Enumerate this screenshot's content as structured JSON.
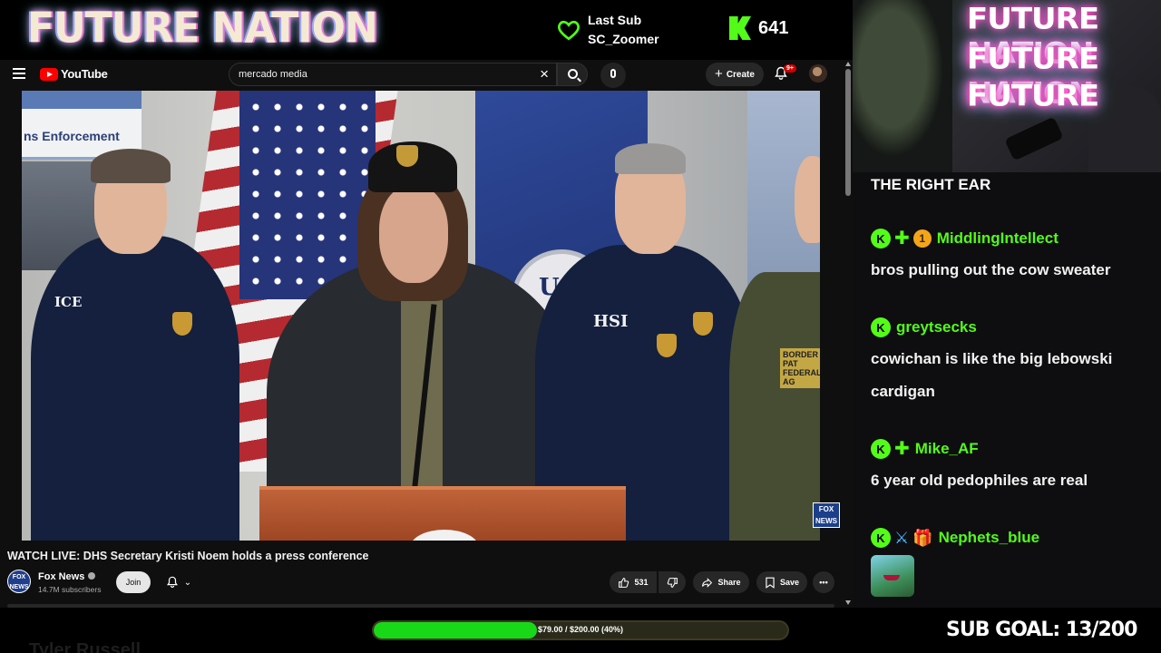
{
  "overlay": {
    "brand": "FUTURE NATION",
    "last_sub_label": "Last Sub",
    "last_sub_user": "SC_Zoomer",
    "kick_viewers": "641",
    "sub_goal": "SUB GOAL: 13/200",
    "goal_progress_text": "$79.00 / $200.00 (40%)",
    "goal_progress_fraction": 0.395,
    "accent_color": "#53fc18",
    "ghost_text": "Tyler Russell"
  },
  "youtube": {
    "logo_text": "YouTube",
    "search_value": "mercado media",
    "create_label": "Create",
    "notif_badge": "9+",
    "video_banner_text": "ns Enforcement",
    "video_title": "WATCH LIVE: DHS Secretary Kristi Noem holds a press conference",
    "channel_name": "Fox News",
    "channel_subs": "14.7M subscribers",
    "channel_avatar_text": "FOX NEWS",
    "join_label": "Join",
    "like_count": "531",
    "share_label": "Share",
    "save_label": "Save",
    "fox_bug": "FOX NEWS",
    "jacket_labels": [
      "ICE",
      "HSI",
      "BORDER PAT FEDERAL AG"
    ],
    "seal_text": "U.S"
  },
  "cam": {
    "neon_lines": [
      "FUTURE NATION",
      "FUTURE NATION",
      "FUTURE"
    ]
  },
  "chat": {
    "title": "THE RIGHT EAR",
    "messages": [
      {
        "user": "MiddlingIntellect",
        "badges": [
          "kick",
          "star",
          "coin-1"
        ],
        "text": "bros pulling out the cow sweater"
      },
      {
        "user": "greytsecks",
        "badges": [
          "kick"
        ],
        "text": "cowichan is like the big lebowski cardigan"
      },
      {
        "user": "Mike_AF",
        "badges": [
          "kick",
          "star"
        ],
        "text": "6 year old pedophiles are real"
      },
      {
        "user": "Nephets_blue",
        "badges": [
          "kick",
          "sword",
          "gift"
        ],
        "text": ""
      }
    ],
    "coin_badge_text": "1"
  }
}
